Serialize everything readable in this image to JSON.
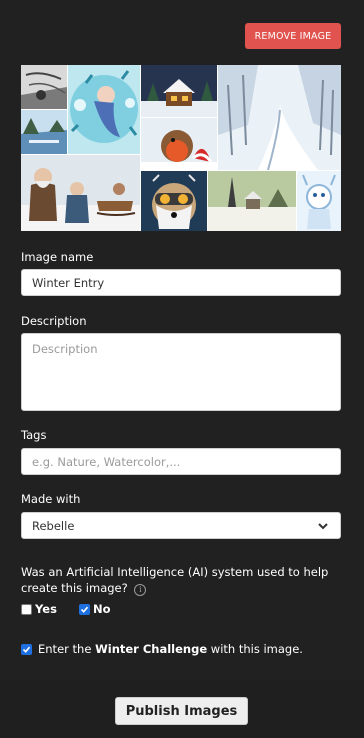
{
  "header": {
    "remove_label": "REMOVE IMAGE"
  },
  "collage": {
    "tiles": [
      "storm-sketch",
      "ice-maiden",
      "snowy-cabin",
      "winter-forest",
      "frozen-lake",
      "robin-bird",
      "old-men-sled",
      "husky-goggles",
      "snowy-village",
      "snow-creature",
      "winter-trees"
    ]
  },
  "form": {
    "image_name": {
      "label": "Image name",
      "value": "Winter Entry"
    },
    "description": {
      "label": "Description",
      "placeholder": "Description"
    },
    "tags": {
      "label": "Tags",
      "placeholder": "e.g. Nature, Watercolor,..."
    },
    "made_with": {
      "label": "Made with",
      "selected": "Rebelle"
    },
    "ai_question": {
      "text": "Was an Artificial Intelligence (AI) system used to help create this image?",
      "info_glyph": "i",
      "yes_label": "Yes",
      "no_label": "No",
      "yes_checked": false,
      "no_checked": true
    },
    "challenge": {
      "prefix": "Enter the ",
      "name": "Winter Challenge",
      "suffix": " with this image.",
      "checked": true
    }
  },
  "footer": {
    "publish_label": "Publish Images"
  },
  "colors": {
    "accent_red": "#e0534f",
    "checkbox_blue": "#1e6fe0",
    "panel_bg": "#212121"
  }
}
